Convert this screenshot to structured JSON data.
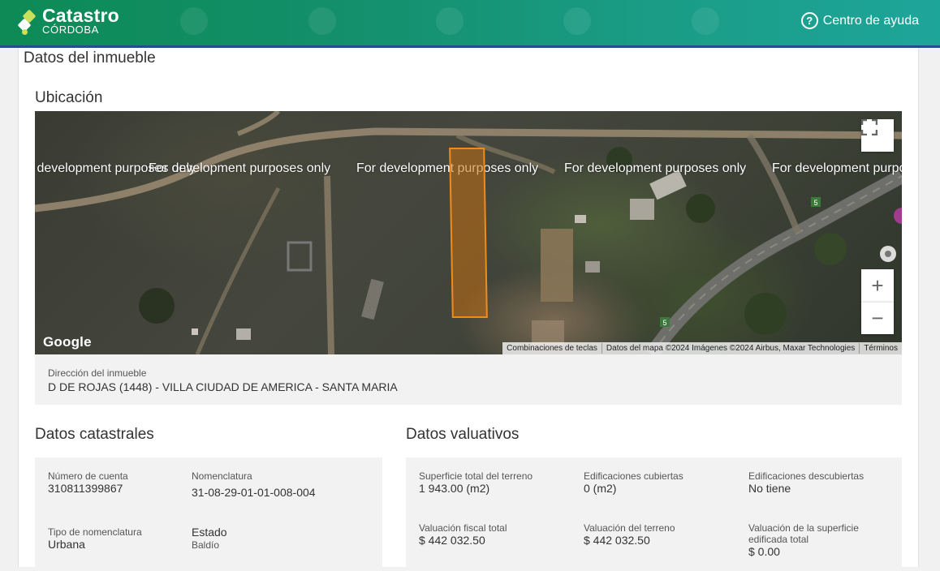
{
  "header": {
    "brand_title": "Catastro",
    "brand_sub": "CÓRDOBA",
    "help_label": "Centro de ayuda",
    "colors": {
      "header_start": "#0d8a55",
      "header_end": "#1ea59a",
      "accent_lime": "#c9e05a",
      "strip": "#1f4f8f"
    }
  },
  "page": {
    "title": "Datos del inmueble"
  },
  "ubicacion": {
    "title": "Ubicación",
    "map": {
      "watermark": "For development purposes only",
      "provider": "Google",
      "attrib_shortcuts": "Combinaciones de teclas",
      "attrib_data": "Datos del mapa ©2024 Imágenes ©2024 Airbus, Maxar Technologies",
      "attrib_terms": "Términos",
      "fullscreen_icon": "fullscreen-icon",
      "zoom_in": "+",
      "zoom_out": "−",
      "parcel_color": "#ef8b1b",
      "road_label": "5"
    },
    "address_label": "Dirección del inmueble",
    "address_value": "D DE ROJAS (1448) - VILLA CIUDAD DE AMERICA - SANTA MARIA"
  },
  "catastrales": {
    "title": "Datos catastrales",
    "cuenta_label": "Número de cuenta",
    "cuenta_value": "310811399867",
    "nomenclatura_label": "Nomenclatura",
    "nomenclatura_value": "31-08-29-01-01-008-004",
    "tipo_label": "Tipo de nomenclatura",
    "tipo_value": "Urbana",
    "estado_label": "Estado",
    "estado_value": "Baldío"
  },
  "valuativos": {
    "title": "Datos valuativos",
    "superficie_label": "Superficie total del terreno",
    "superficie_value": "1 943.00 (m2)",
    "cubiertas_label": "Edificaciones cubiertas",
    "cubiertas_value": "0 (m2)",
    "descubiertas_label": "Edificaciones descubiertas",
    "descubiertas_value": "No tiene",
    "fiscal_label": "Valuación fiscal total",
    "fiscal_value": "$ 442 032.50",
    "terreno_label": "Valuación del terreno",
    "terreno_value": "$ 442 032.50",
    "edificada_label": "Valuación de la superficie edificada total",
    "edificada_value": "$ 0.00"
  }
}
